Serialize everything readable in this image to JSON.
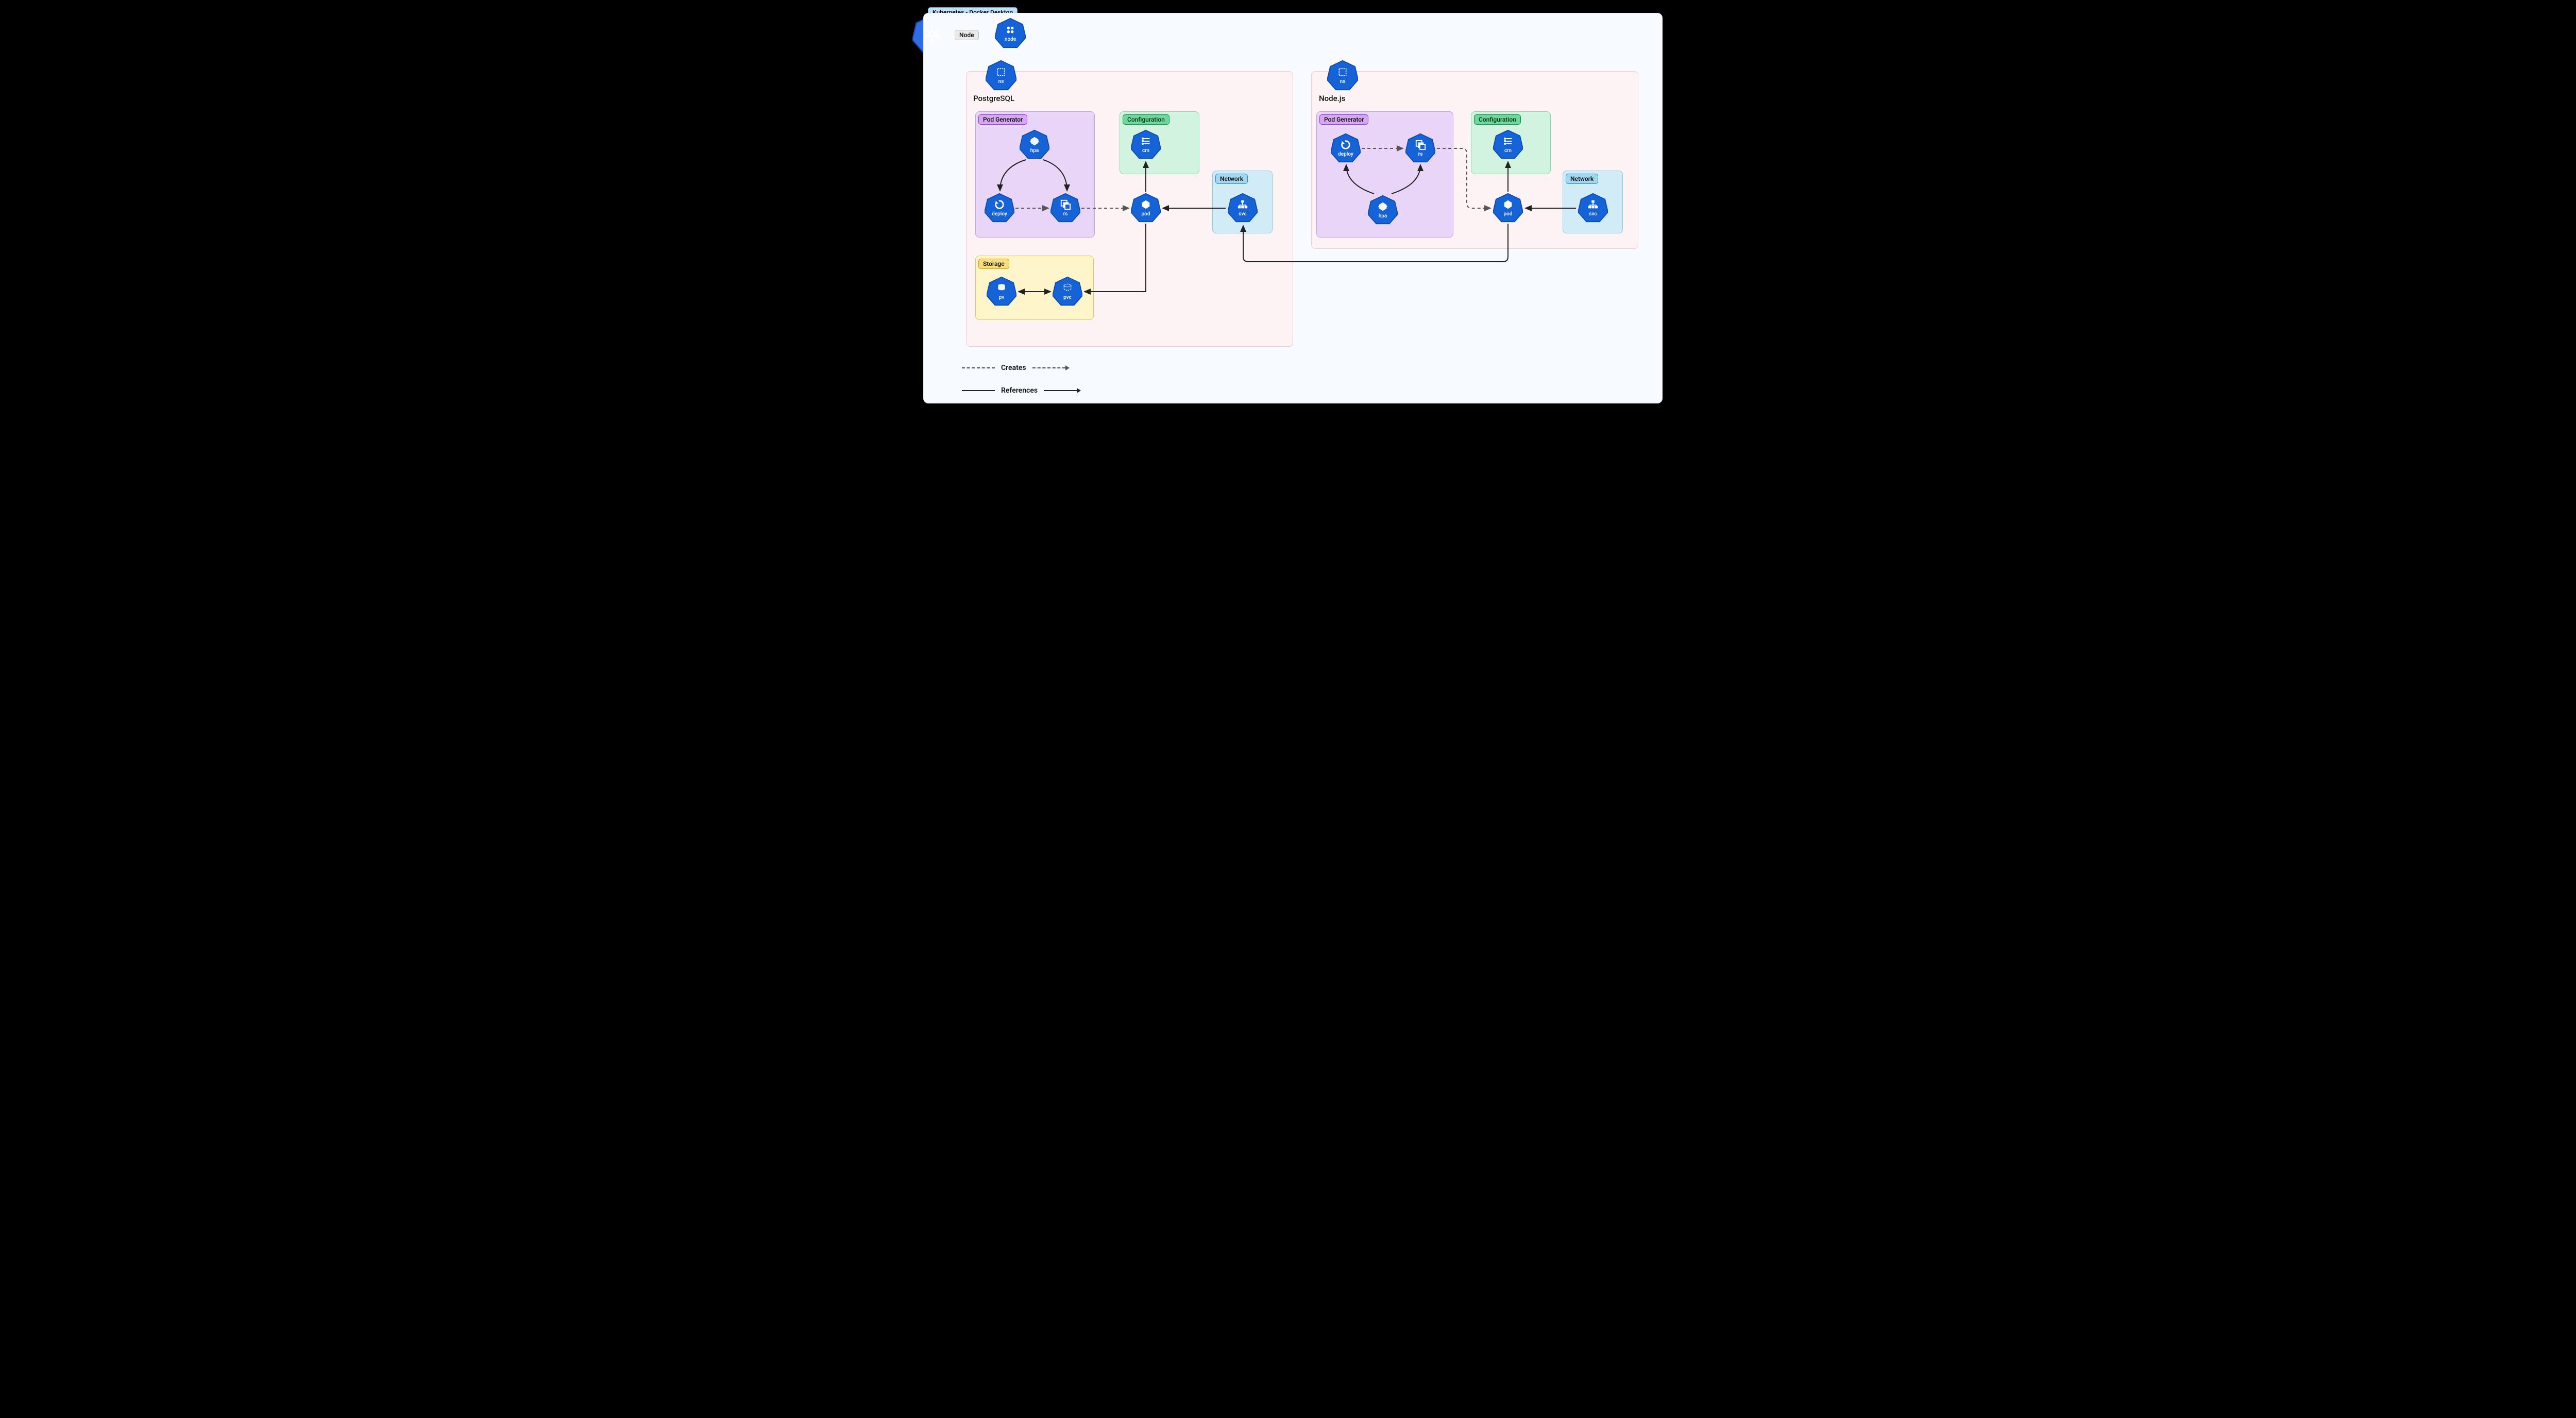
{
  "title_tag": "Kubernetes - Docker Desktop",
  "node_tag": "Node",
  "namespaces": {
    "left": {
      "label": "PostgreSQL",
      "ns_icon": "ns"
    },
    "right": {
      "label": "Node.js",
      "ns_icon": "ns"
    }
  },
  "group_tags": {
    "pod_generator": "Pod Generator",
    "configuration": "Configuration",
    "network": "Network",
    "storage": "Storage"
  },
  "icons": {
    "node": "node",
    "ns": "ns",
    "hpa": "hpa",
    "deploy": "deploy",
    "rs": "rs",
    "cm": "cm",
    "pod": "pod",
    "svc": "svc",
    "pv": "pv",
    "pvc": "pvc"
  },
  "legend": {
    "creates": "Creates",
    "references": "References"
  },
  "colors": {
    "k8s_blue": "#1563d7",
    "purple": "#e8d5f7",
    "green": "#d1f3e0",
    "yellow": "#fef5cb",
    "blue": "#d2ecf7",
    "pink": "#fdf2f4"
  },
  "diagram": {
    "nodes": [
      {
        "id": "node",
        "kind": "node"
      },
      {
        "id": "ns-l",
        "kind": "ns",
        "ns": "PostgreSQL"
      },
      {
        "id": "ns-r",
        "kind": "ns",
        "ns": "Node.js"
      },
      {
        "id": "hpa-l",
        "kind": "hpa",
        "ns": "PostgreSQL",
        "group": "Pod Generator"
      },
      {
        "id": "deploy-l",
        "kind": "deploy",
        "ns": "PostgreSQL",
        "group": "Pod Generator"
      },
      {
        "id": "rs-l",
        "kind": "rs",
        "ns": "PostgreSQL",
        "group": "Pod Generator"
      },
      {
        "id": "cm-l",
        "kind": "cm",
        "ns": "PostgreSQL",
        "group": "Configuration"
      },
      {
        "id": "pod-l",
        "kind": "pod",
        "ns": "PostgreSQL"
      },
      {
        "id": "svc-l",
        "kind": "svc",
        "ns": "PostgreSQL",
        "group": "Network"
      },
      {
        "id": "pv-l",
        "kind": "pv",
        "ns": "PostgreSQL",
        "group": "Storage"
      },
      {
        "id": "pvc-l",
        "kind": "pvc",
        "ns": "PostgreSQL",
        "group": "Storage"
      },
      {
        "id": "deploy-r",
        "kind": "deploy",
        "ns": "Node.js",
        "group": "Pod Generator"
      },
      {
        "id": "rs-r",
        "kind": "rs",
        "ns": "Node.js",
        "group": "Pod Generator"
      },
      {
        "id": "hpa-r",
        "kind": "hpa",
        "ns": "Node.js",
        "group": "Pod Generator"
      },
      {
        "id": "cm-r",
        "kind": "cm",
        "ns": "Node.js",
        "group": "Configuration"
      },
      {
        "id": "pod-r",
        "kind": "pod",
        "ns": "Node.js"
      },
      {
        "id": "svc-r",
        "kind": "svc",
        "ns": "Node.js",
        "group": "Network"
      }
    ],
    "edges": [
      {
        "from": "hpa-l",
        "to": "deploy-l",
        "kind": "references"
      },
      {
        "from": "hpa-l",
        "to": "rs-l",
        "kind": "references"
      },
      {
        "from": "deploy-l",
        "to": "rs-l",
        "kind": "creates"
      },
      {
        "from": "rs-l",
        "to": "pod-l",
        "kind": "creates"
      },
      {
        "from": "pod-l",
        "to": "cm-l",
        "kind": "references"
      },
      {
        "from": "svc-l",
        "to": "pod-l",
        "kind": "references"
      },
      {
        "from": "pod-l",
        "to": "pvc-l",
        "kind": "references"
      },
      {
        "from": "pvc-l",
        "to": "pv-l",
        "kind": "references",
        "bidirectional": true
      },
      {
        "from": "deploy-r",
        "to": "rs-r",
        "kind": "creates"
      },
      {
        "from": "hpa-r",
        "to": "deploy-r",
        "kind": "references"
      },
      {
        "from": "hpa-r",
        "to": "rs-r",
        "kind": "references"
      },
      {
        "from": "rs-r",
        "to": "pod-r",
        "kind": "creates"
      },
      {
        "from": "pod-r",
        "to": "cm-r",
        "kind": "references"
      },
      {
        "from": "svc-r",
        "to": "pod-r",
        "kind": "references"
      },
      {
        "from": "pod-r",
        "to": "svc-l",
        "kind": "references"
      }
    ]
  }
}
